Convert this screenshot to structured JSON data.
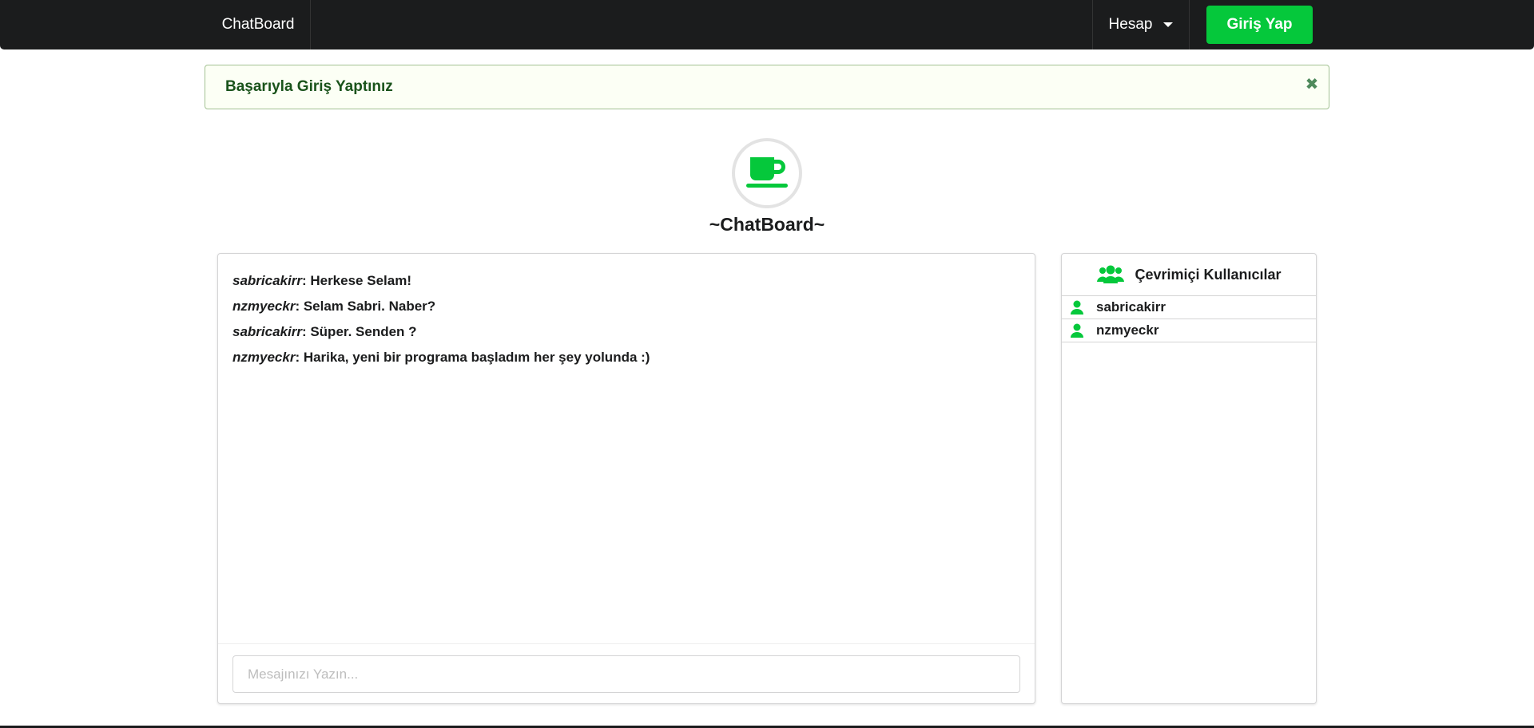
{
  "navbar": {
    "brand": "ChatBoard",
    "account_label": "Hesap",
    "login_label": "Giriş Yap"
  },
  "alert": {
    "message": "Başarıyla Giriş Yaptınız",
    "close_icon": "✖"
  },
  "page": {
    "title": "~ChatBoard~",
    "logo_icon": "coffee-cup-icon"
  },
  "chat": {
    "messages": [
      {
        "user": "sabricakirr",
        "text": ": Herkese Selam!"
      },
      {
        "user": "nzmyeckr",
        "text": ": Selam Sabri. Naber?"
      },
      {
        "user": "sabricakirr",
        "text": ": Süper. Senden ?"
      },
      {
        "user": "nzmyeckr",
        "text": ": Harika, yeni bir programa başladım her şey yolunda :)"
      }
    ],
    "input_placeholder": "Mesajınızı Yazın..."
  },
  "users_panel": {
    "title": "Çevrimiçi Kullanıcılar",
    "users": [
      "sabricakirr",
      "nzmyeckr"
    ]
  },
  "colors": {
    "accent": "#05c83b",
    "navbar_bg": "#1b1c1d",
    "alert_text": "#1a531b"
  }
}
